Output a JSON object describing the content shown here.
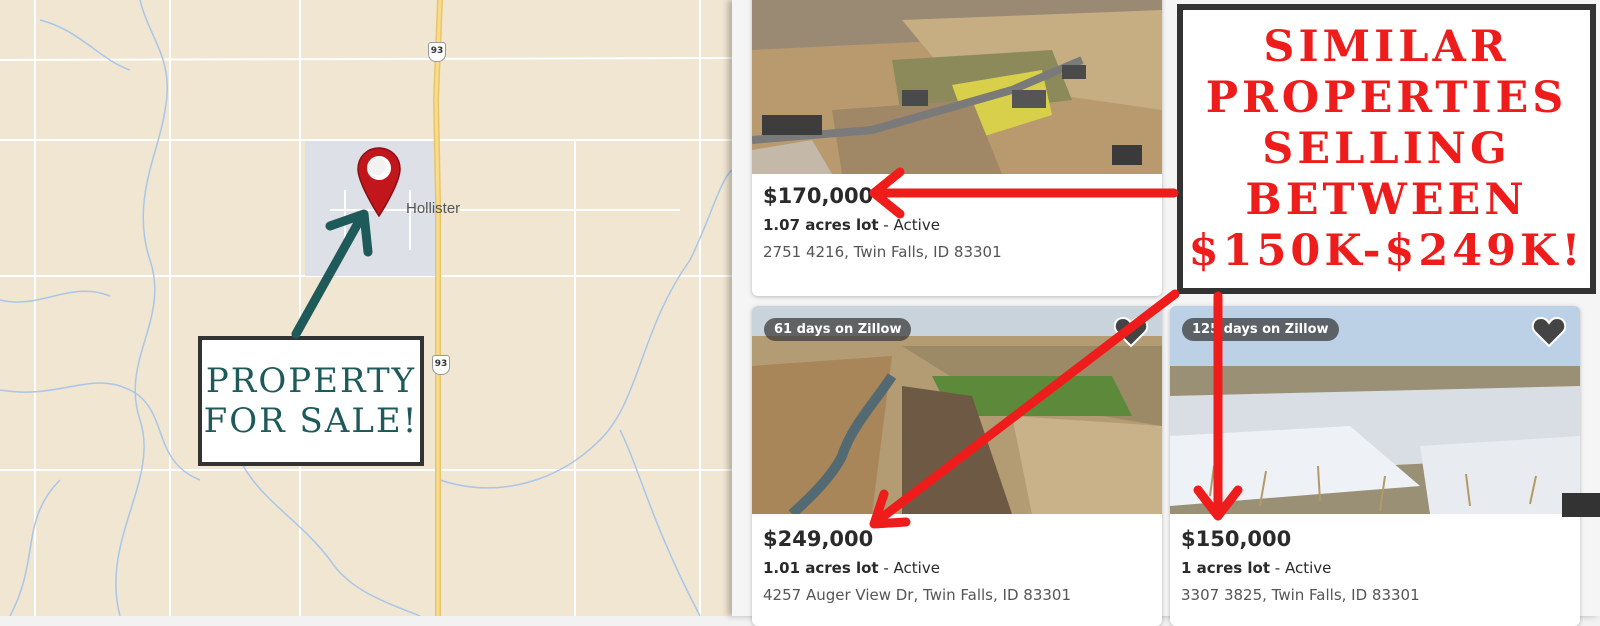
{
  "map": {
    "town": "Hollister",
    "route_shields": [
      "93",
      "93"
    ],
    "callout": {
      "line1": "PROPERTY",
      "line2": "FOR SALE!"
    }
  },
  "listings": [
    {
      "price": "$170,000",
      "size": "1.07 acres lot",
      "status": " - Active",
      "address": "2751 4216, Twin Falls, ID 83301",
      "badge": ""
    },
    {
      "price": "$249,000",
      "size": "1.01 acres lot",
      "status": " - Active",
      "address": "4257 Auger View Dr, Twin Falls, ID 83301",
      "badge": "61 days on Zillow"
    },
    {
      "price": "$150,000",
      "size": "1 acres lot",
      "status": " - Active",
      "address": "3307 3825, Twin Falls, ID 83301",
      "badge": "125 days on Zillow"
    }
  ],
  "callout": {
    "lines": [
      "SIMILAR",
      "PROPERTIES",
      "SELLING",
      "BETWEEN",
      "$150K-$249K!"
    ]
  },
  "colors": {
    "callout_red": "#ef1c1c",
    "property_teal": "#1e5a5a",
    "pin": "#c0161c"
  },
  "icons": {
    "pin": "map-pin-icon",
    "favorite": "heart-icon"
  }
}
